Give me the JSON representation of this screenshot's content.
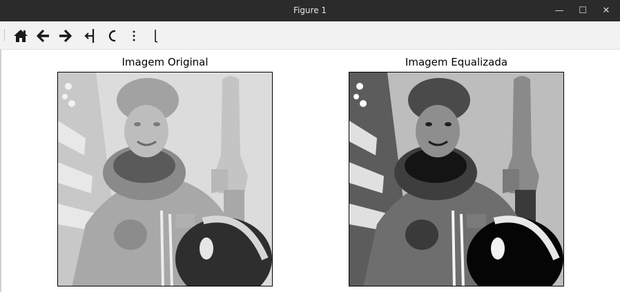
{
  "window": {
    "title": "Figure 1",
    "minimize": "—",
    "maximize": "☐",
    "close": "✕"
  },
  "toolbar": {
    "buttons": [
      {
        "icon": "home-icon"
      },
      {
        "icon": "back-arrow-icon"
      },
      {
        "icon": "forward-arrow-icon"
      },
      {
        "icon": "pan-icon"
      },
      {
        "icon": "zoom-icon"
      },
      {
        "icon": "configure-subplots-icon"
      },
      {
        "icon": "save-icon"
      }
    ]
  },
  "figure": {
    "left_title": "Imagem Original",
    "right_title": "Imagem Equalizada"
  }
}
